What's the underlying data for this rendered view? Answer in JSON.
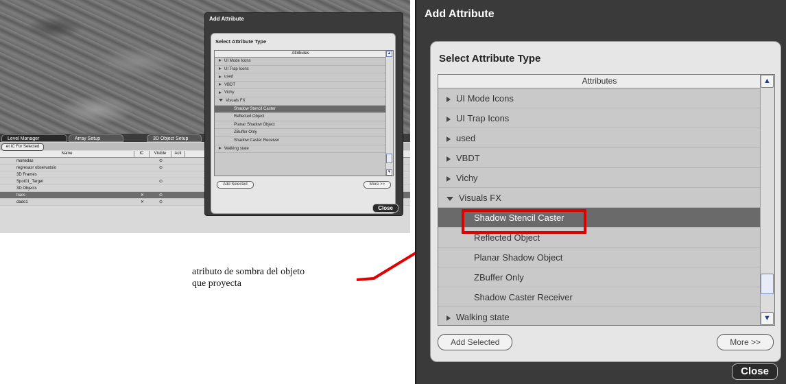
{
  "left": {
    "tabs": [
      "Level Manager",
      "Array Setup",
      "3D Object Setup"
    ],
    "select_button": "et IC For Selected",
    "columns": [
      "Name",
      "IC",
      "Visible",
      "Acti"
    ],
    "rows": [
      {
        "name": "monedas",
        "ic": "",
        "vis": "⊙",
        "extra": [
          "",
          "",
          ""
        ],
        "sel": false
      },
      {
        "name": "regresasr observatoio",
        "ic": "",
        "vis": "⊙",
        "extra": [
          "",
          "",
          ""
        ],
        "sel": false
      },
      {
        "name": "3D Frames",
        "ic": "",
        "vis": "",
        "extra": [
          "",
          "",
          ""
        ],
        "sel": false
      },
      {
        "name": "Spot01_Target",
        "ic": "",
        "vis": "⊙",
        "extra": [
          "",
          "",
          ""
        ],
        "sel": false
      },
      {
        "name": "3D Objects",
        "ic": "",
        "vis": "",
        "extra": [
          "",
          "",
          ""
        ],
        "sel": false
      },
      {
        "name": "tracs",
        "ic": "✕",
        "vis": "⊙",
        "extra": [
          "A",
          "R",
          "A"
        ],
        "sel": true
      },
      {
        "name": "dado1",
        "ic": "✕",
        "vis": "⊙",
        "extra": [
          "A",
          "R",
          "A"
        ],
        "sel": false
      }
    ]
  },
  "dialog": {
    "title": "Add Attribute",
    "section_title": "Select Attribute Type",
    "list_header": "Attributes",
    "items": [
      {
        "label": "UI Mode Icons",
        "type": "collapsed"
      },
      {
        "label": "UI Trap Icons",
        "type": "collapsed"
      },
      {
        "label": "used",
        "type": "collapsed"
      },
      {
        "label": "VBDT",
        "type": "collapsed"
      },
      {
        "label": "Vichy",
        "type": "collapsed"
      },
      {
        "label": "Visuals FX",
        "type": "expanded"
      },
      {
        "label": "Shadow Stencil Caster",
        "type": "sub",
        "selected": true
      },
      {
        "label": "Reflected Object",
        "type": "sub"
      },
      {
        "label": "Planar Shadow Object",
        "type": "sub"
      },
      {
        "label": "ZBuffer Only",
        "type": "sub"
      },
      {
        "label": "Shadow Caster Receiver",
        "type": "sub"
      },
      {
        "label": "Walking state",
        "type": "collapsed"
      }
    ],
    "add_selected_label": "Add Selected",
    "more_label": "More >>",
    "close_label": "Close"
  },
  "annotation": {
    "line1": "atributo de sombra del objeto",
    "line2": "que proyecta",
    "color": "#e00000"
  }
}
